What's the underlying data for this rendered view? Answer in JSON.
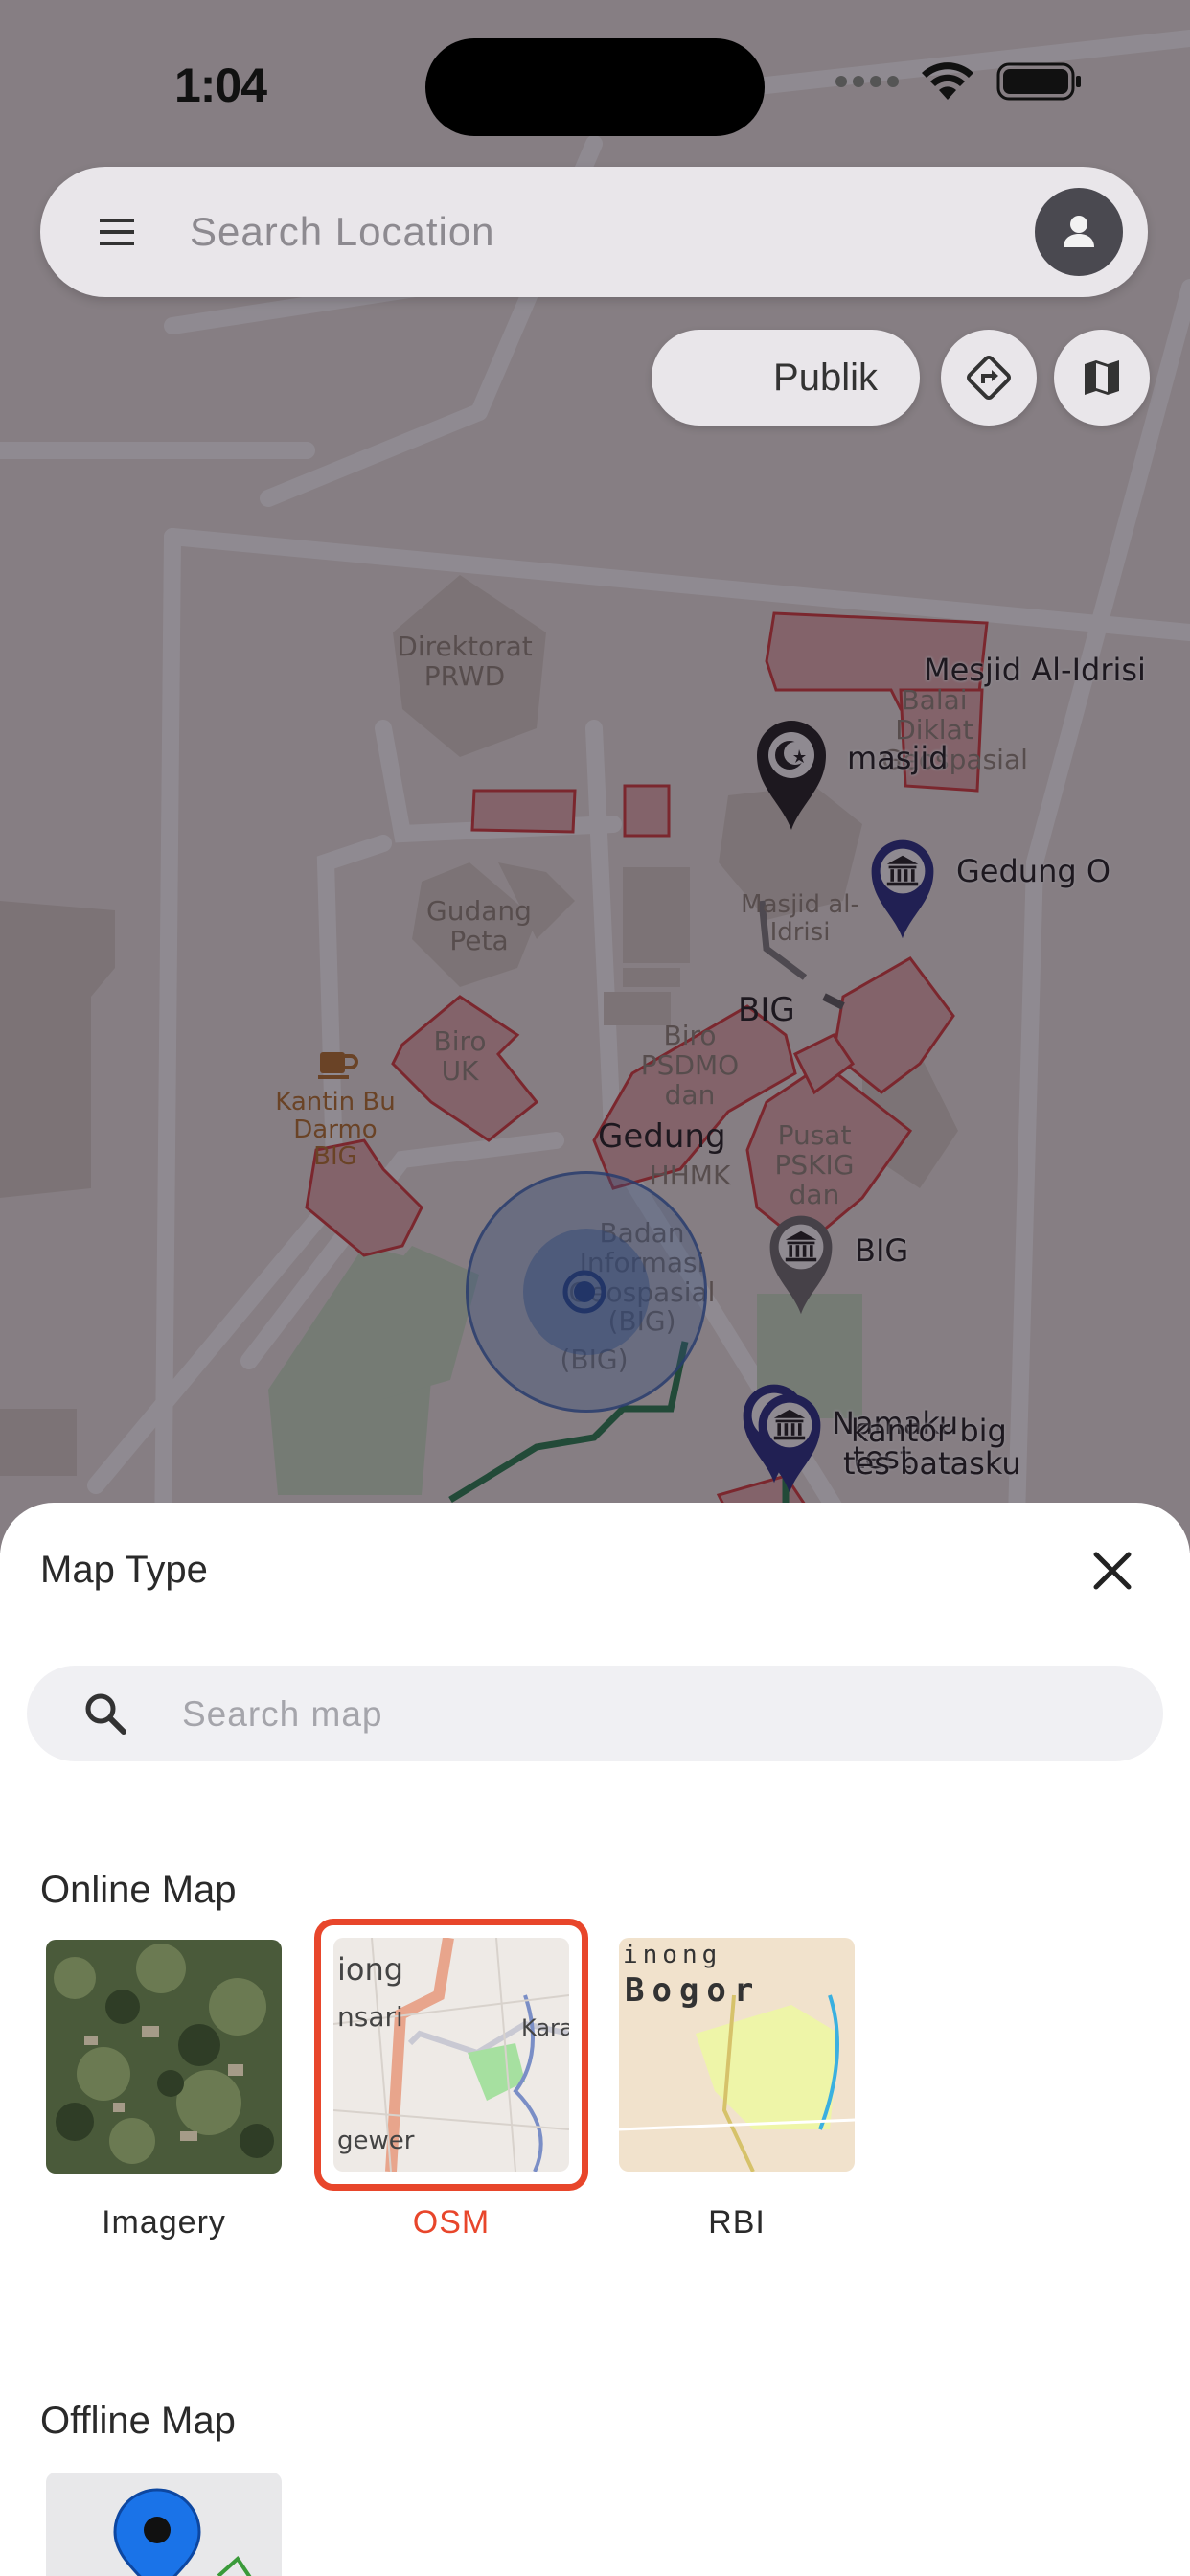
{
  "status": {
    "time": "1:04"
  },
  "search": {
    "placeholder": "Search Location"
  },
  "controls": {
    "publik_label": "Publik"
  },
  "map_labels": {
    "direktorat": "Direktorat PRWD",
    "gudang": "Gudang Peta",
    "biro_uk": "Biro UK",
    "kantin": "Kantin Bu Darmo BIG",
    "biro_psdmo": "Biro PSDMO dan",
    "hhmk": "HHMK",
    "pusat": "Pusat PSKIG dan",
    "badan": "Badan Informasi Geospasial (BIG)",
    "big_paren": "(BIG)",
    "balai": "Balai Diklat Geospasial",
    "masjid_alidrisi_building": "Masjid al-Idrisi",
    "big_a": "BIG",
    "gedung": "Gedung",
    "mesjid": "Mesjid Al-Idrisi",
    "masjid": "masjid",
    "gedung_o": "Gedung O",
    "big_b": "BIG",
    "namaku": "Namaku",
    "kantor": "kantor big",
    "test": "test",
    "tes_batasku": "tes batasku"
  },
  "sheet": {
    "title": "Map Type",
    "search_placeholder": "Search map",
    "online_title": "Online Map",
    "offline_title": "Offline Map",
    "online_maps": [
      {
        "label": "Imagery",
        "selected": false
      },
      {
        "label": "OSM",
        "selected": true
      },
      {
        "label": "RBI",
        "selected": false
      }
    ],
    "osm_tile_text": [
      "iong",
      "nsari",
      "Kara",
      "gewer"
    ],
    "rbi_tile_text": [
      "inong",
      "Bogor"
    ]
  },
  "colors": {
    "accent": "#e8462b",
    "pin_dark": "#1a237e",
    "pin_black": "#111111",
    "pin_grey": "#666666"
  },
  "icons": [
    "menu-icon",
    "person-icon",
    "directions-icon",
    "map-icon",
    "close-icon",
    "search-icon",
    "location-pin-icon",
    "museum-icon",
    "mosque-icon",
    "coffee-icon",
    "wifi-icon",
    "battery-icon"
  ]
}
